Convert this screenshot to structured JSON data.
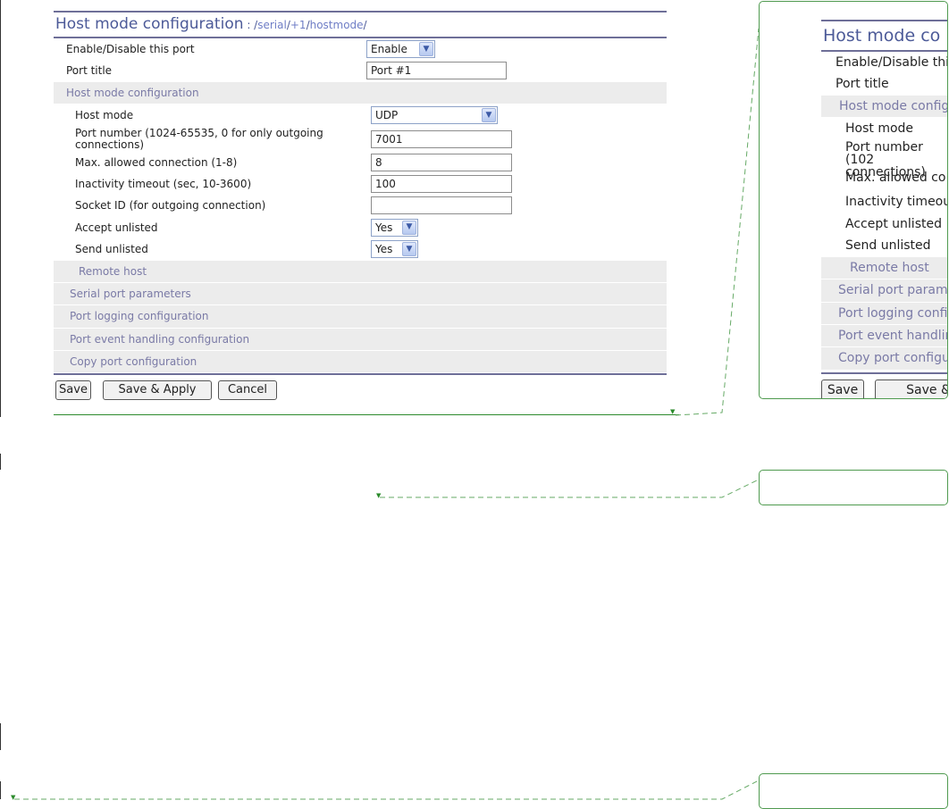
{
  "header": {
    "title": "Host mode configuration",
    "sep": " : /",
    "path_serial": "serial",
    "slash1": "/",
    "path_port": "+1",
    "slash2": "/",
    "path_hostmode": "hostmode",
    "slash3": "/"
  },
  "fields": {
    "enable": {
      "label": "Enable/Disable this port",
      "value": "Enable"
    },
    "port_title": {
      "label": "Port title",
      "value": "Port #1"
    },
    "host_mode_section": "Host mode configuration",
    "host_mode": {
      "label": "Host mode",
      "value": "UDP"
    },
    "port_number": {
      "label": "Port number (1024-65535, 0 for only outgoing connections)",
      "value": "7001"
    },
    "max_conn": {
      "label": "Max. allowed connection (1-8)",
      "value": "8"
    },
    "inactivity": {
      "label": "Inactivity timeout (sec, 10-3600)",
      "value": "100"
    },
    "socket_id": {
      "label": "Socket ID (for outgoing connection)",
      "value": ""
    },
    "accept_unlisted": {
      "label": "Accept unlisted",
      "value": "Yes"
    },
    "send_unlisted": {
      "label": "Send unlisted",
      "value": "Yes"
    }
  },
  "sections": {
    "remote_host": "Remote host",
    "serial_params": "Serial port parameters",
    "logging": "Port logging configuration",
    "event_handling": "Port event handling configuration",
    "copy": "Copy port configuration"
  },
  "buttons": {
    "save": "Save",
    "save_apply": "Save & Apply",
    "cancel": "Cancel"
  },
  "zoom": {
    "title": "Host mode co",
    "enable": "Enable/Disable thi",
    "port_title": "Port title",
    "host_mode_section": "Host mode config",
    "host_mode": "Host mode",
    "port_number": "Port number (102 connections)",
    "max_conn": "Max. allowed co",
    "inactivity": "Inactivity timeout",
    "accept_unlisted": "Accept unlisted",
    "send_unlisted": "Send unlisted",
    "remote_host": "Remote host",
    "serial_params": "Serial port parame",
    "logging": "Port logging config",
    "event_handling": "Port event handlin",
    "copy": "Copy port configu",
    "save": "Save",
    "save_apply": "Save &"
  },
  "colors": {
    "accent": "#4c5a98",
    "rule": "#6e6f98",
    "section_bg": "#ececec",
    "callout": "#4f9a4f"
  }
}
